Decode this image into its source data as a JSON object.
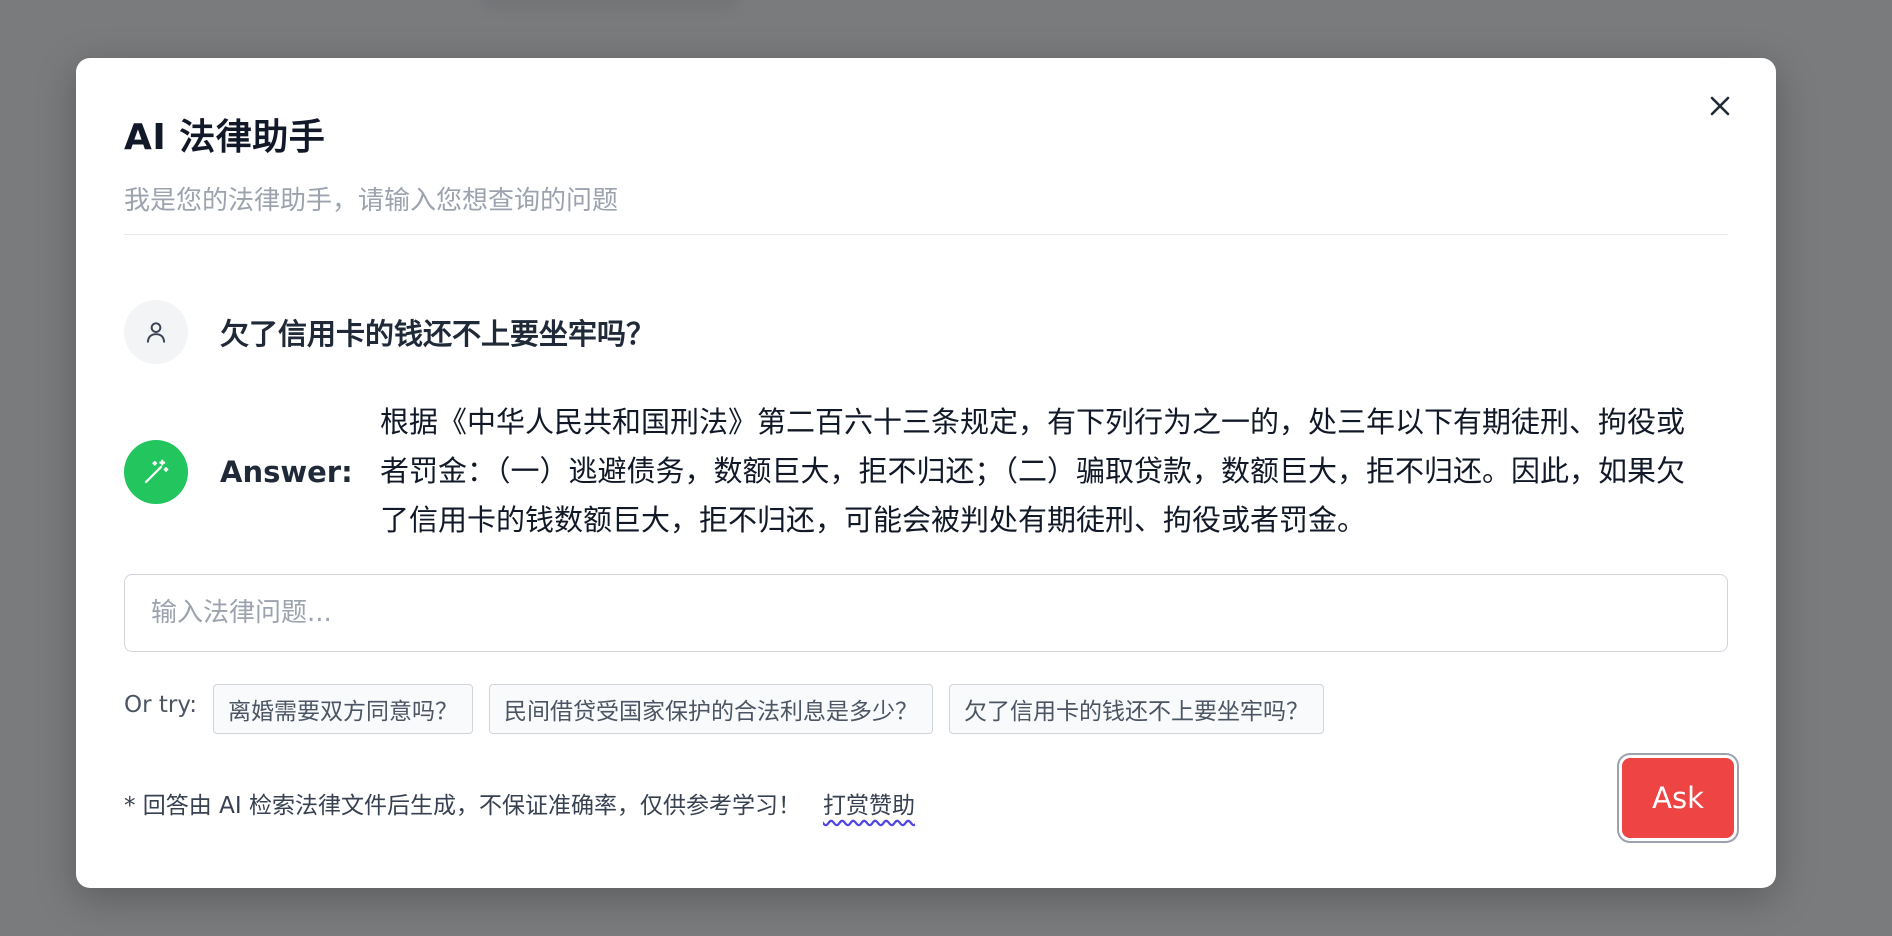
{
  "dialog": {
    "title": "AI 法律助手",
    "subtitle": "我是您的法律助手，请输入您想查询的问题",
    "close_icon": "close-icon"
  },
  "conversation": {
    "question": "欠了信用卡的钱还不上要坐牢吗？",
    "answer_label": "Answer:",
    "answer": "根据《中华人民共和国刑法》第二百六十三条规定，有下列行为之一的，处三年以下有期徒刑、拘役或者罚金：（一）逃避债务，数额巨大，拒不归还；（二）骗取贷款，数额巨大，拒不归还。因此，如果欠了信用卡的钱数额巨大，拒不归还，可能会被判处有期徒刑、拘役或者罚金。",
    "user_icon": "user-icon",
    "ai_icon": "magic-wand-icon"
  },
  "input": {
    "placeholder": "输入法律问题...",
    "value": ""
  },
  "suggestions": {
    "label": "Or try:",
    "items": [
      "离婚需要双方同意吗？",
      "民间借贷受国家保护的合法利息是多少？",
      "欠了信用卡的钱还不上要坐牢吗？"
    ]
  },
  "footer": {
    "disclaimer": "* 回答由 AI 检索法律文件后生成，不保证准确率，仅供参考学习！",
    "donate_link": "打赏赞助",
    "ask_button": "Ask"
  },
  "colors": {
    "accent_green": "#22c55e",
    "ask_red": "#ef4444"
  }
}
